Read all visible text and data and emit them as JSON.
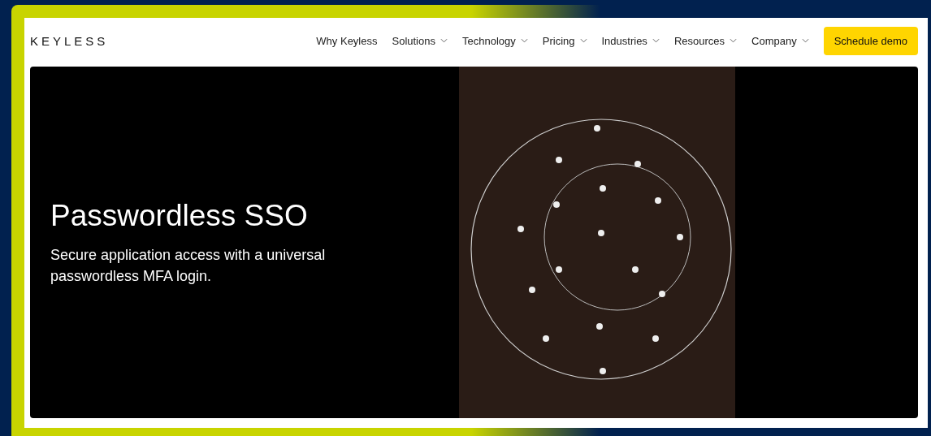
{
  "header": {
    "logo": "KEYLESS",
    "nav": [
      {
        "label": "Why Keyless",
        "has_menu": false
      },
      {
        "label": "Solutions",
        "has_menu": true
      },
      {
        "label": "Technology",
        "has_menu": true
      },
      {
        "label": "Pricing",
        "has_menu": true
      },
      {
        "label": "Industries",
        "has_menu": true
      },
      {
        "label": "Resources",
        "has_menu": true
      },
      {
        "label": "Company",
        "has_menu": true
      }
    ],
    "cta": "Schedule demo"
  },
  "hero": {
    "title": "Passwordless SSO",
    "subtitle": "Secure application access with a universal passwordless MFA login."
  }
}
